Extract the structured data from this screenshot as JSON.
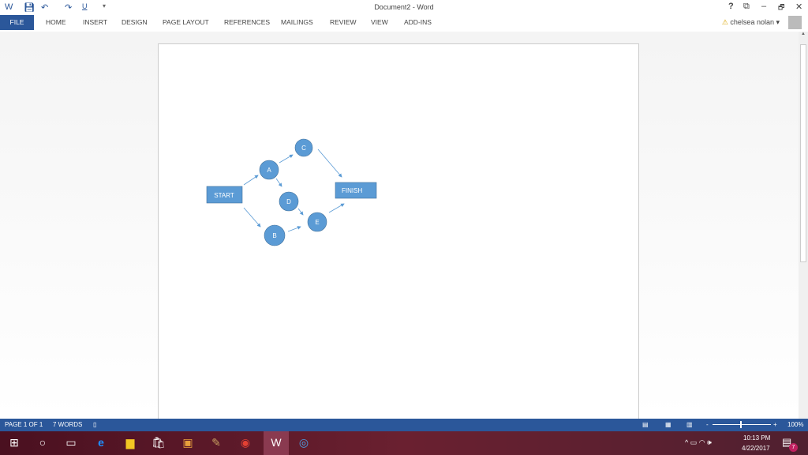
{
  "titlebar": {
    "title": "Document2 - Word",
    "help": "?",
    "ribbon_display": "⧉",
    "minimize": "–",
    "restore": "🗗",
    "close": "✕"
  },
  "ribbon": {
    "tabs": [
      "FILE",
      "HOME",
      "INSERT",
      "DESIGN",
      "PAGE LAYOUT",
      "REFERENCES",
      "MAILINGS",
      "REVIEW",
      "VIEW",
      "ADD-INS"
    ],
    "user": "chelsea nolan",
    "warning": "⚠"
  },
  "diagram": {
    "start": "START",
    "finish": "FINISH",
    "nodes": {
      "a": "A",
      "b": "B",
      "c": "C",
      "d": "D",
      "e": "E"
    },
    "fill": "#5b9bd5",
    "edge": "#5b9bd5"
  },
  "status": {
    "page": "PAGE 1 OF 1",
    "words": "7 WORDS",
    "zoom": "100%"
  },
  "taskbar": {
    "time": "10:13 PM",
    "date": "4/22/2017",
    "notifications": "7"
  }
}
